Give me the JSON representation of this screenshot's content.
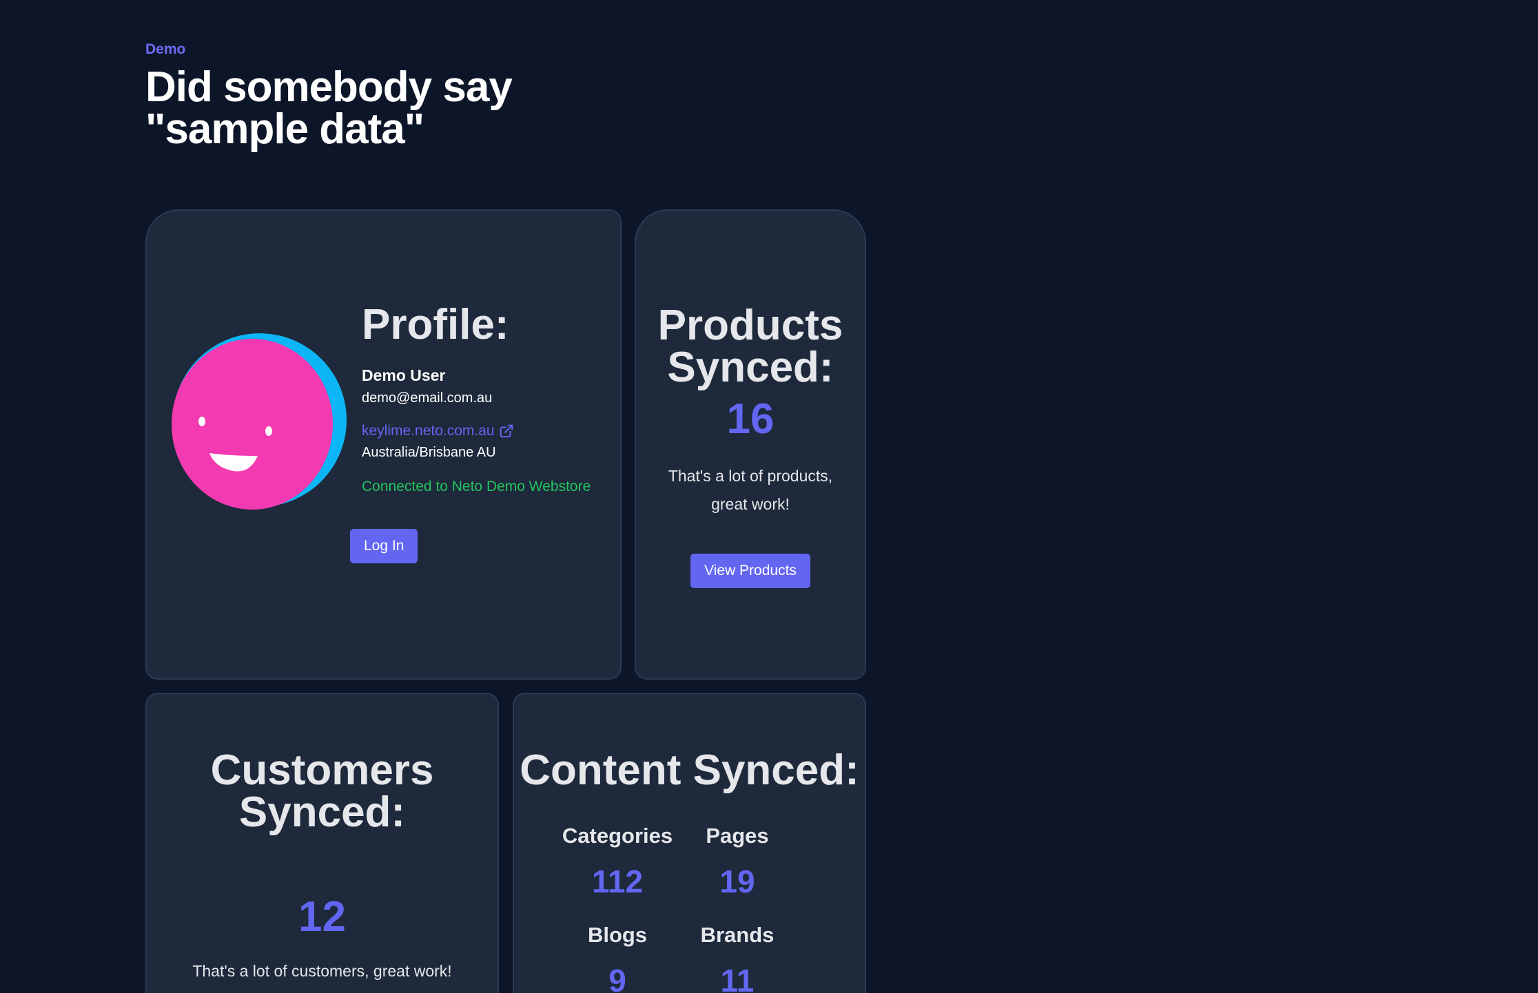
{
  "header": {
    "eyebrow": "Demo",
    "title": "Did somebody say \"sample data\""
  },
  "profile": {
    "title": "Profile:",
    "name": "Demo User",
    "email": "demo@email.com.au",
    "store_url": "keylime.neto.com.au",
    "location": "Australia/Brisbane AU",
    "connection_status": "Connected to Neto Demo Webstore",
    "login_label": "Log In",
    "avatar_icon": "smiley-avatar-icon"
  },
  "products": {
    "title": "Products Synced:",
    "count": "16",
    "note": "That's a lot of products, great work!",
    "button_label": "View Products"
  },
  "customers": {
    "title": "Customers Synced:",
    "count": "12",
    "note": "That's a lot of customers, great work!"
  },
  "content": {
    "title": "Content Synced:",
    "items": [
      {
        "label": "Categories",
        "value": "112"
      },
      {
        "label": "Pages",
        "value": "19"
      },
      {
        "label": "Blogs",
        "value": "9"
      },
      {
        "label": "Brands",
        "value": "11"
      }
    ]
  },
  "colors": {
    "background": "#0d1628",
    "card": "#1e293b",
    "accent": "#6366f1",
    "success": "#22c55e",
    "avatar_pink": "#f43ab0",
    "avatar_blue": "#0bb5f6"
  }
}
